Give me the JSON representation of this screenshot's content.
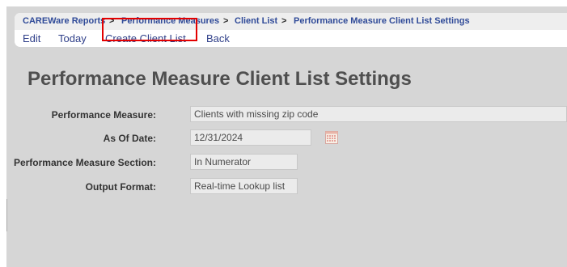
{
  "breadcrumb": {
    "items": [
      "CAREWare Reports",
      "Performance Measures",
      "Client List",
      "Performance Measure Client List Settings"
    ],
    "separator": ">"
  },
  "menu": {
    "items": [
      "Edit",
      "Today",
      "Create Client List",
      "Back"
    ],
    "highlighted": "Create Client List"
  },
  "page": {
    "title": "Performance Measure Client List Settings"
  },
  "fields": [
    {
      "label": "Performance Measure:",
      "value": "Clients with missing zip code"
    },
    {
      "label": "As Of Date:",
      "value": "12/31/2024",
      "icon": "calendar-icon"
    },
    {
      "label": "Performance Measure Section:",
      "value": "In Numerator"
    },
    {
      "label": "Output Format:",
      "value": "Real-time Lookup list"
    }
  ],
  "colors": {
    "link": "#2f3f89",
    "breadcrumb": "#2f4a98",
    "highlight": "#e30000",
    "page_bg": "#d6d6d6"
  }
}
